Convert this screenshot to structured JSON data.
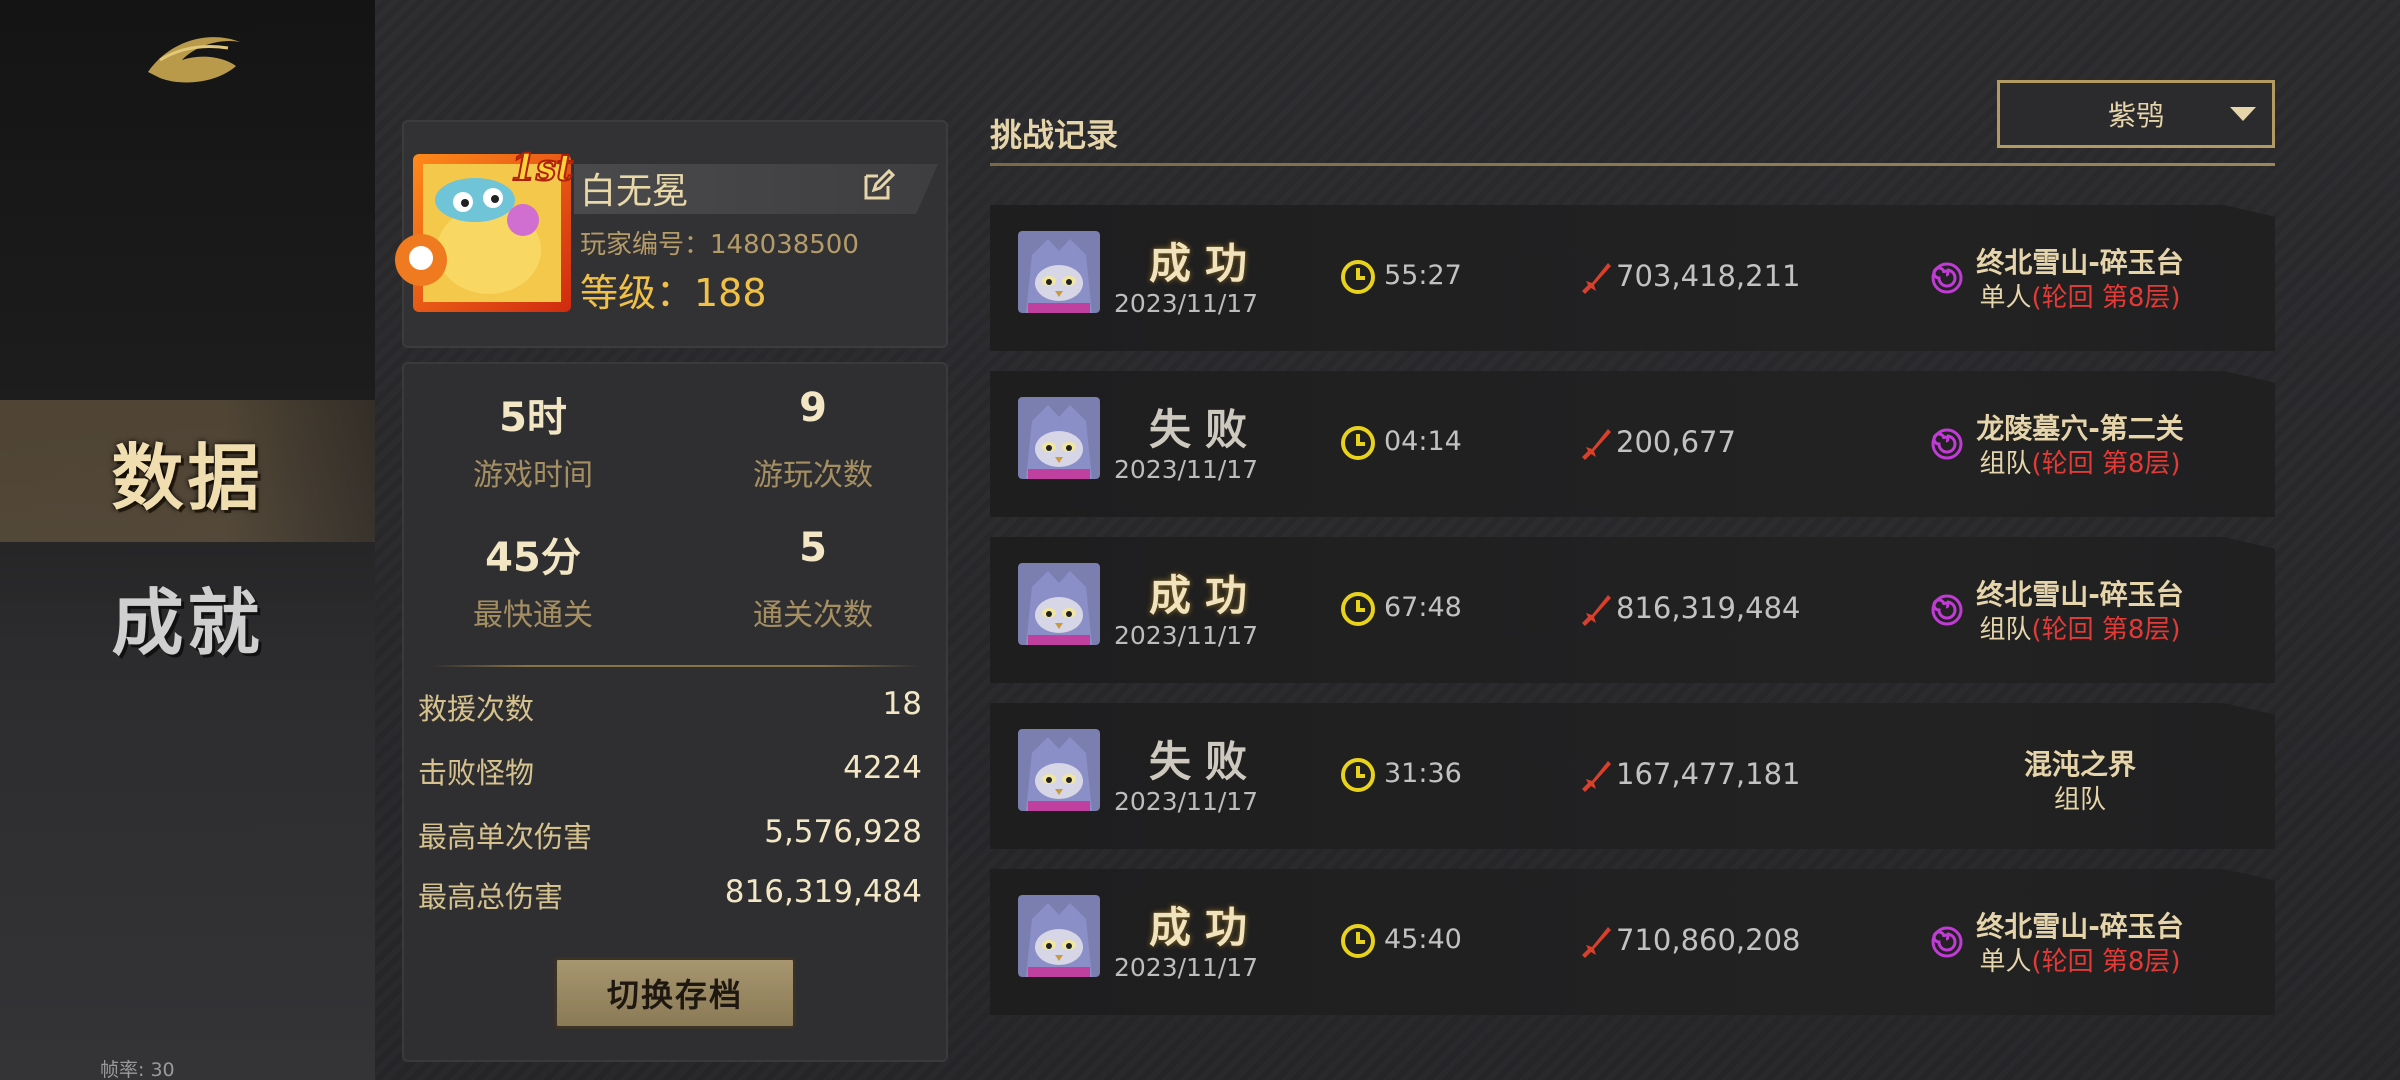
{
  "sidebar": {
    "nav_data": "数据",
    "nav_achievements": "成就",
    "fps": "帧率: 30"
  },
  "profile": {
    "rank_badge": "1st",
    "name": "白无冕",
    "player_id": "玩家编号：148038500",
    "level": "等级：188"
  },
  "stats": {
    "play_time_value": "5时",
    "play_time_label": "游戏时间",
    "play_count_value": "9",
    "play_count_label": "游玩次数",
    "fastest_value": "45分",
    "fastest_label": "最快通关",
    "clear_count_value": "5",
    "clear_count_label": "通关次数",
    "rows": [
      {
        "label": "救援次数",
        "value": "18"
      },
      {
        "label": "击败怪物",
        "value": "4224"
      },
      {
        "label": "最高单次伤害",
        "value": "5,576,928"
      },
      {
        "label": "最高总伤害",
        "value": "816,319,484"
      }
    ],
    "switch_button": "切换存档"
  },
  "records": {
    "title": "挑战记录",
    "filter_selected": "紫鸮",
    "items": [
      {
        "status": "成功",
        "win": true,
        "date": "2023/11/17",
        "time": "55:27",
        "damage": "703,418,211",
        "stage": "终北雪山-碎玉台",
        "mode": "单人",
        "mode_extra": "(轮回  第8层)",
        "swirl": true
      },
      {
        "status": "失败",
        "win": false,
        "date": "2023/11/17",
        "time": "04:14",
        "damage": "200,677",
        "stage": "龙陵墓穴-第二关",
        "mode": "组队",
        "mode_extra": "(轮回  第8层)",
        "swirl": true
      },
      {
        "status": "成功",
        "win": true,
        "date": "2023/11/17",
        "time": "67:48",
        "damage": "816,319,484",
        "stage": "终北雪山-碎玉台",
        "mode": "组队",
        "mode_extra": "(轮回  第8层)",
        "swirl": true
      },
      {
        "status": "失败",
        "win": false,
        "date": "2023/11/17",
        "time": "31:36",
        "damage": "167,477,181",
        "stage": "混沌之界",
        "mode": "组队",
        "mode_extra": "",
        "swirl": false
      },
      {
        "status": "成功",
        "win": true,
        "date": "2023/11/17",
        "time": "45:40",
        "damage": "710,860,208",
        "stage": "终北雪山-碎玉台",
        "mode": "单人",
        "mode_extra": "(轮回  第8层)",
        "swirl": true
      }
    ]
  },
  "colors": {
    "gold": "#d8c28a",
    "level_gold": "#f0c048",
    "red": "#e23a36",
    "swirl_purple": "#c23bd6",
    "clock_yellow": "#e8d21c"
  }
}
